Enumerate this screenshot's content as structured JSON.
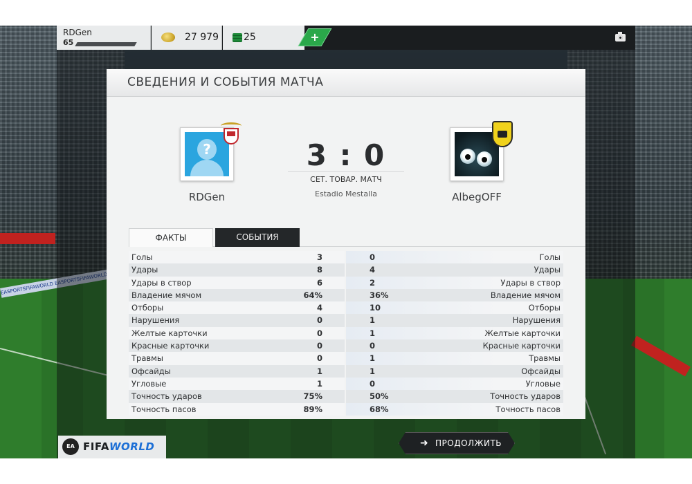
{
  "topbar": {
    "username": "RDGen",
    "level": "65",
    "coins": "27 979",
    "points": "25",
    "add_label": "+"
  },
  "panel": {
    "title": "СВЕДЕНИЯ И СОБЫТИЯ МАТЧА"
  },
  "match": {
    "home_team": "RDGen",
    "away_team": "AlbegOFF",
    "home_avatar_glyph": "?",
    "score": "3 : 0",
    "match_type": "СЕТ. ТОВАР. МАТЧ",
    "stadium": "Estadio Mestalla"
  },
  "tabs": {
    "facts": "ФАКТЫ",
    "events": "СОБЫТИЯ"
  },
  "stats": [
    {
      "label": "Голы",
      "home": "3",
      "away": "0"
    },
    {
      "label": "Удары",
      "home": "8",
      "away": "4"
    },
    {
      "label": "Удары в створ",
      "home": "6",
      "away": "2"
    },
    {
      "label": "Владение мячом",
      "home": "64%",
      "away": "36%"
    },
    {
      "label": "Отборы",
      "home": "4",
      "away": "10"
    },
    {
      "label": "Нарушения",
      "home": "0",
      "away": "1"
    },
    {
      "label": "Желтые карточки",
      "home": "0",
      "away": "1"
    },
    {
      "label": "Красные карточки",
      "home": "0",
      "away": "0"
    },
    {
      "label": "Травмы",
      "home": "0",
      "away": "1"
    },
    {
      "label": "Офсайды",
      "home": "1",
      "away": "1"
    },
    {
      "label": "Угловые",
      "home": "1",
      "away": "0"
    },
    {
      "label": "Точность ударов",
      "home": "75%",
      "away": "50%"
    },
    {
      "label": "Точность пасов",
      "home": "89%",
      "away": "68%"
    }
  ],
  "bottombar": {
    "continue_label": "ПРОДОЛЖИТЬ",
    "logo_fifa": "FIFA",
    "logo_world": "WORLD",
    "ea_label": "EA"
  },
  "adboards": {
    "left_board": "EASPORTSFIFAWORLD EASPORTSFIFAWORLD"
  },
  "icons": {
    "coin": "coin-icon",
    "points": "fifa-points-icon",
    "camera": "camera-icon",
    "continue_arrow": "arrow-right-icon"
  }
}
